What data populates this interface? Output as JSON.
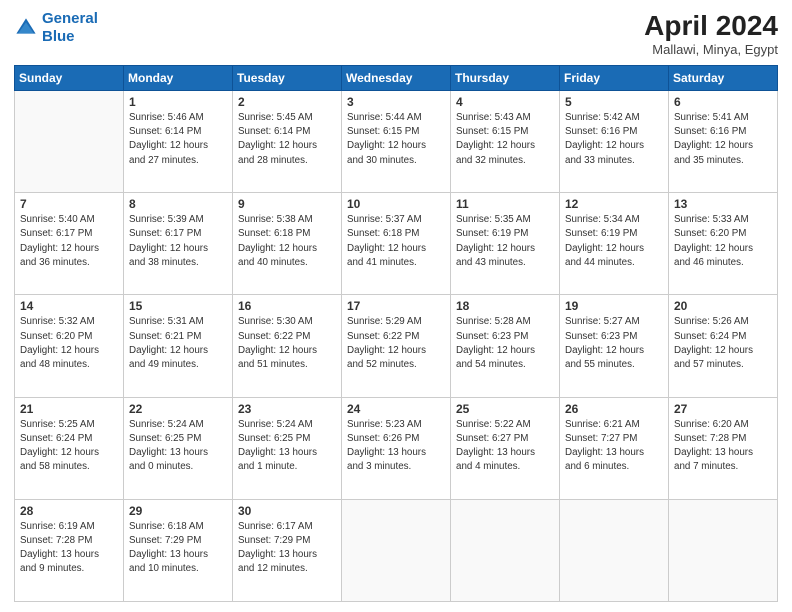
{
  "logo": {
    "line1": "General",
    "line2": "Blue"
  },
  "title": "April 2024",
  "subtitle": "Mallawi, Minya, Egypt",
  "days_header": [
    "Sunday",
    "Monday",
    "Tuesday",
    "Wednesday",
    "Thursday",
    "Friday",
    "Saturday"
  ],
  "weeks": [
    [
      {
        "day": "",
        "info": ""
      },
      {
        "day": "1",
        "info": "Sunrise: 5:46 AM\nSunset: 6:14 PM\nDaylight: 12 hours\nand 27 minutes."
      },
      {
        "day": "2",
        "info": "Sunrise: 5:45 AM\nSunset: 6:14 PM\nDaylight: 12 hours\nand 28 minutes."
      },
      {
        "day": "3",
        "info": "Sunrise: 5:44 AM\nSunset: 6:15 PM\nDaylight: 12 hours\nand 30 minutes."
      },
      {
        "day": "4",
        "info": "Sunrise: 5:43 AM\nSunset: 6:15 PM\nDaylight: 12 hours\nand 32 minutes."
      },
      {
        "day": "5",
        "info": "Sunrise: 5:42 AM\nSunset: 6:16 PM\nDaylight: 12 hours\nand 33 minutes."
      },
      {
        "day": "6",
        "info": "Sunrise: 5:41 AM\nSunset: 6:16 PM\nDaylight: 12 hours\nand 35 minutes."
      }
    ],
    [
      {
        "day": "7",
        "info": "Sunrise: 5:40 AM\nSunset: 6:17 PM\nDaylight: 12 hours\nand 36 minutes."
      },
      {
        "day": "8",
        "info": "Sunrise: 5:39 AM\nSunset: 6:17 PM\nDaylight: 12 hours\nand 38 minutes."
      },
      {
        "day": "9",
        "info": "Sunrise: 5:38 AM\nSunset: 6:18 PM\nDaylight: 12 hours\nand 40 minutes."
      },
      {
        "day": "10",
        "info": "Sunrise: 5:37 AM\nSunset: 6:18 PM\nDaylight: 12 hours\nand 41 minutes."
      },
      {
        "day": "11",
        "info": "Sunrise: 5:35 AM\nSunset: 6:19 PM\nDaylight: 12 hours\nand 43 minutes."
      },
      {
        "day": "12",
        "info": "Sunrise: 5:34 AM\nSunset: 6:19 PM\nDaylight: 12 hours\nand 44 minutes."
      },
      {
        "day": "13",
        "info": "Sunrise: 5:33 AM\nSunset: 6:20 PM\nDaylight: 12 hours\nand 46 minutes."
      }
    ],
    [
      {
        "day": "14",
        "info": "Sunrise: 5:32 AM\nSunset: 6:20 PM\nDaylight: 12 hours\nand 48 minutes."
      },
      {
        "day": "15",
        "info": "Sunrise: 5:31 AM\nSunset: 6:21 PM\nDaylight: 12 hours\nand 49 minutes."
      },
      {
        "day": "16",
        "info": "Sunrise: 5:30 AM\nSunset: 6:22 PM\nDaylight: 12 hours\nand 51 minutes."
      },
      {
        "day": "17",
        "info": "Sunrise: 5:29 AM\nSunset: 6:22 PM\nDaylight: 12 hours\nand 52 minutes."
      },
      {
        "day": "18",
        "info": "Sunrise: 5:28 AM\nSunset: 6:23 PM\nDaylight: 12 hours\nand 54 minutes."
      },
      {
        "day": "19",
        "info": "Sunrise: 5:27 AM\nSunset: 6:23 PM\nDaylight: 12 hours\nand 55 minutes."
      },
      {
        "day": "20",
        "info": "Sunrise: 5:26 AM\nSunset: 6:24 PM\nDaylight: 12 hours\nand 57 minutes."
      }
    ],
    [
      {
        "day": "21",
        "info": "Sunrise: 5:25 AM\nSunset: 6:24 PM\nDaylight: 12 hours\nand 58 minutes."
      },
      {
        "day": "22",
        "info": "Sunrise: 5:24 AM\nSunset: 6:25 PM\nDaylight: 13 hours\nand 0 minutes."
      },
      {
        "day": "23",
        "info": "Sunrise: 5:24 AM\nSunset: 6:25 PM\nDaylight: 13 hours\nand 1 minute."
      },
      {
        "day": "24",
        "info": "Sunrise: 5:23 AM\nSunset: 6:26 PM\nDaylight: 13 hours\nand 3 minutes."
      },
      {
        "day": "25",
        "info": "Sunrise: 5:22 AM\nSunset: 6:27 PM\nDaylight: 13 hours\nand 4 minutes."
      },
      {
        "day": "26",
        "info": "Sunrise: 6:21 AM\nSunset: 7:27 PM\nDaylight: 13 hours\nand 6 minutes."
      },
      {
        "day": "27",
        "info": "Sunrise: 6:20 AM\nSunset: 7:28 PM\nDaylight: 13 hours\nand 7 minutes."
      }
    ],
    [
      {
        "day": "28",
        "info": "Sunrise: 6:19 AM\nSunset: 7:28 PM\nDaylight: 13 hours\nand 9 minutes."
      },
      {
        "day": "29",
        "info": "Sunrise: 6:18 AM\nSunset: 7:29 PM\nDaylight: 13 hours\nand 10 minutes."
      },
      {
        "day": "30",
        "info": "Sunrise: 6:17 AM\nSunset: 7:29 PM\nDaylight: 13 hours\nand 12 minutes."
      },
      {
        "day": "",
        "info": ""
      },
      {
        "day": "",
        "info": ""
      },
      {
        "day": "",
        "info": ""
      },
      {
        "day": "",
        "info": ""
      }
    ]
  ]
}
